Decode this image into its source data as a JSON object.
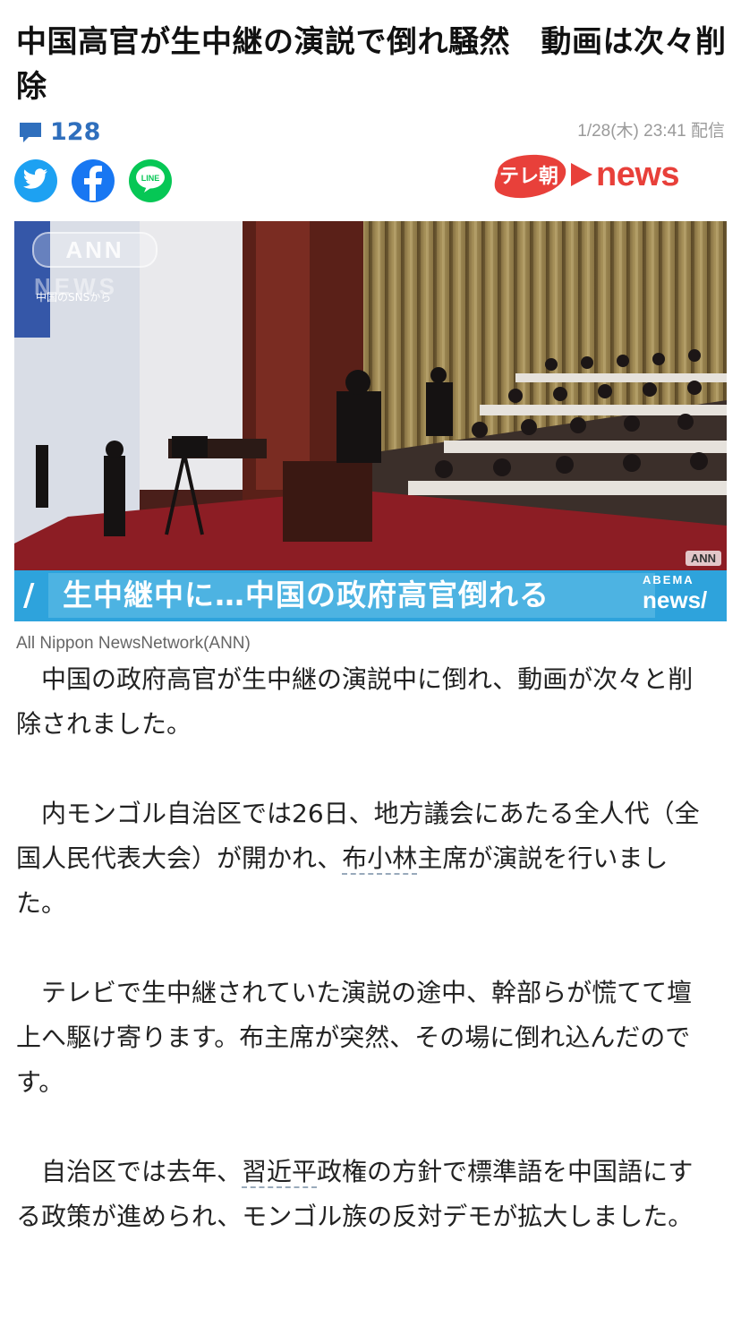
{
  "article": {
    "title": "中国高官が生中継の演説で倒れ騒然　動画は次々削除",
    "comment_count": "128",
    "published": "1/28(木) 23:41 配信"
  },
  "share": {
    "twitter_icon": "twitter-icon",
    "facebook_icon": "facebook-icon",
    "line_icon": "line-icon",
    "line_label": "LINE"
  },
  "brand": {
    "badge": "テレ朝",
    "news": "news",
    "color": "#e8403a"
  },
  "photo": {
    "logo": "ANN",
    "logo_news": "NEWS",
    "source_label": "中国のSNSから",
    "corner_logo": "ANN",
    "telop_slash": "/",
    "telop": "生中継中に…中国の政府高官倒れる",
    "abema_small": "ABEMA",
    "abema_big": "news/",
    "caption": "All Nippon NewsNetwork(ANN)"
  },
  "body": {
    "p1": "中国の政府高官が生中継の演説中に倒れ、動画が次々と削除されました。",
    "p2_before": "内モンゴル自治区では26日、地方議会にあたる全人代（全国人民代表大会）が開かれ、",
    "p2_link": "布小林",
    "p2_after": "主席が演説を行いました。",
    "p3": "テレビで生中継されていた演説の途中、幹部らが慌てて壇上へ駆け寄ります。布主席が突然、その場に倒れ込んだのです。",
    "p4_before": "自治区では去年、",
    "p4_link": "習近平",
    "p4_after": "政権の方針で標準語を中国語にする政策が進められ、モンゴル族の反対デモが拡大しました。"
  },
  "colors": {
    "comment": "#2f6fbd",
    "twitter": "#1da1f2",
    "facebook": "#1877f2",
    "line": "#06c755",
    "telop": "#2ea3dc"
  }
}
